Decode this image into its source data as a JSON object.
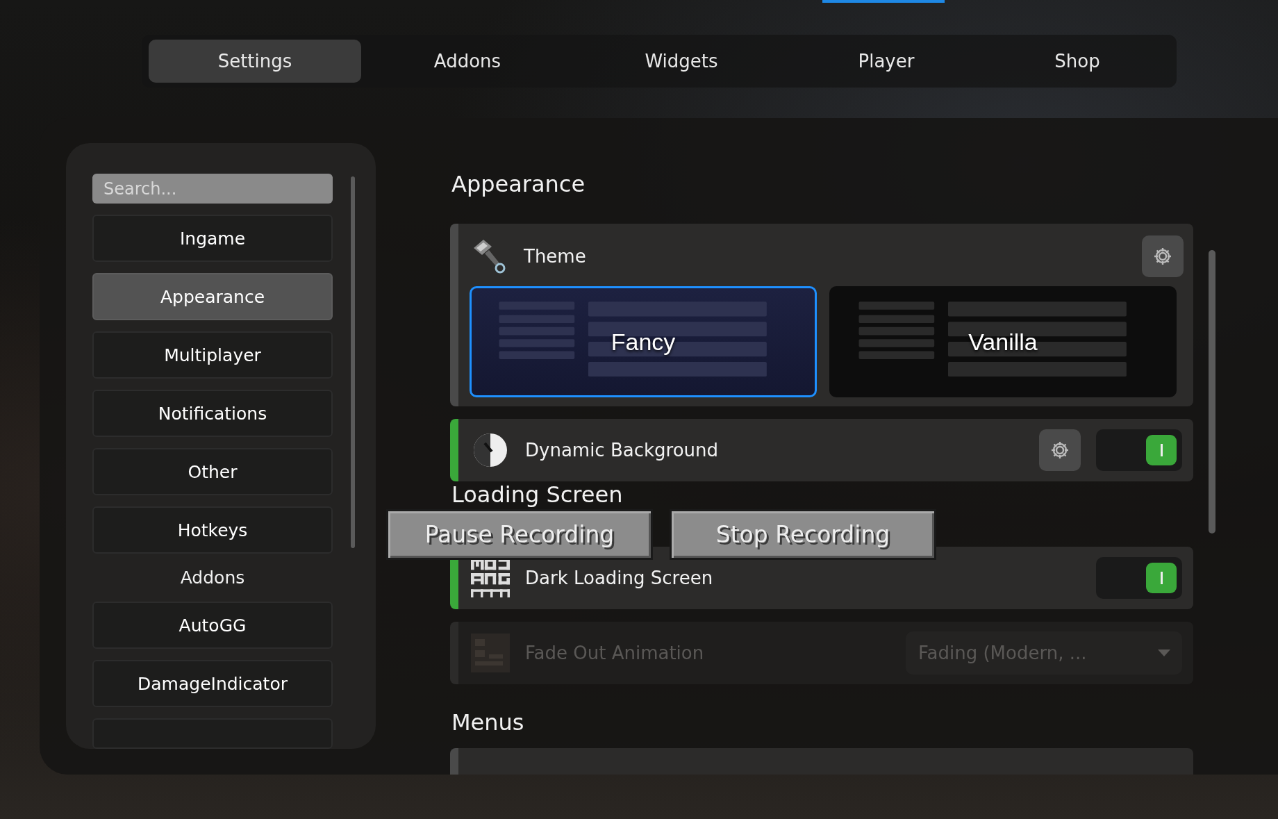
{
  "tabs": [
    {
      "label": "Settings",
      "selected": true
    },
    {
      "label": "Addons",
      "selected": false
    },
    {
      "label": "Widgets",
      "selected": false
    },
    {
      "label": "Player",
      "selected": false
    },
    {
      "label": "Shop",
      "selected": false
    }
  ],
  "sidebar": {
    "search_placeholder": "Search...",
    "items": [
      {
        "label": "Ingame",
        "kind": "button",
        "selected": false
      },
      {
        "label": "Appearance",
        "kind": "button",
        "selected": true
      },
      {
        "label": "Multiplayer",
        "kind": "button",
        "selected": false
      },
      {
        "label": "Notifications",
        "kind": "button",
        "selected": false
      },
      {
        "label": "Other",
        "kind": "button",
        "selected": false
      },
      {
        "label": "Hotkeys",
        "kind": "button",
        "selected": false
      },
      {
        "label": "Addons",
        "kind": "header"
      },
      {
        "label": "AutoGG",
        "kind": "button",
        "selected": false
      },
      {
        "label": "DamageIndicator",
        "kind": "button",
        "selected": false
      }
    ]
  },
  "sections": [
    {
      "title": "Appearance",
      "settings": [
        {
          "kind": "theme",
          "label": "Theme",
          "has_settings": true,
          "options": [
            {
              "label": "Fancy",
              "selected": true
            },
            {
              "label": "Vanilla",
              "selected": false
            }
          ]
        },
        {
          "kind": "toggle",
          "label": "Dynamic Background",
          "has_settings": true,
          "on": true
        }
      ]
    },
    {
      "title": "Loading Screen",
      "settings": [
        {
          "kind": "toggle",
          "label": "Dark Loading Screen",
          "has_settings": false,
          "on": true
        },
        {
          "kind": "dropdown",
          "label": "Fade Out Animation",
          "value": "Fading (Modern, ...",
          "disabled": true
        }
      ]
    },
    {
      "title": "Menus",
      "settings": [
        {
          "kind": "stub"
        }
      ]
    }
  ],
  "recording_overlay": {
    "buttons": [
      "Pause Recording",
      "Stop Recording"
    ]
  }
}
